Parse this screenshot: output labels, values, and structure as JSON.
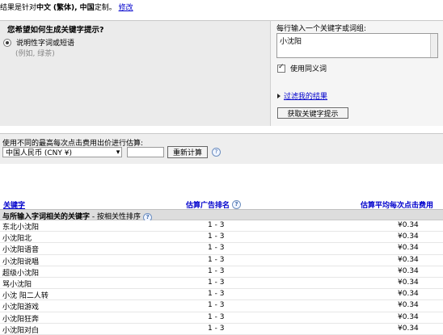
{
  "top": {
    "prefix": "结果是针对",
    "lang": "中文",
    "variant": "(繁体), 中国",
    "suffix": "定制。",
    "edit_link": "修改"
  },
  "question": {
    "title": "您希望如何生成关键字提示?",
    "option_label": "说明性字词或短语",
    "option_example": "(例如, 绿茶)"
  },
  "keywords_panel": {
    "label": "每行输入一个关键字或词组:",
    "value": "小沈阳",
    "synonyms_label": "使用同义词",
    "synonyms_checked": true,
    "filter_link": "过滤我的结果",
    "get_button": "获取关键字提示"
  },
  "cpc": {
    "label": "使用不同的最高每次点击费用出价进行估算:",
    "currency": "中国人民币 (CNY ¥)",
    "bid_value": "",
    "recalc_button": "重新计算"
  },
  "table": {
    "headers": {
      "keyword": "关键字",
      "rank": "估算广告排名",
      "cpc": "估算平均每次点击费用"
    },
    "section_title": "与所输入字词相关的关键字",
    "section_sort": " - 按相关性排序",
    "rows": [
      {
        "keyword": "东北小沈阳",
        "rank": "1 - 3",
        "cpc": "¥0.34"
      },
      {
        "keyword": "小沈阳北",
        "rank": "1 - 3",
        "cpc": "¥0.34"
      },
      {
        "keyword": "小沈阳语音",
        "rank": "1 - 3",
        "cpc": "¥0.34"
      },
      {
        "keyword": "小沈阳说唱",
        "rank": "1 - 3",
        "cpc": "¥0.34"
      },
      {
        "keyword": "超级小沈阳",
        "rank": "1 - 3",
        "cpc": "¥0.34"
      },
      {
        "keyword": "骂小沈阳",
        "rank": "1 - 3",
        "cpc": "¥0.34"
      },
      {
        "keyword": "小沈 阳二人转",
        "rank": "1 - 3",
        "cpc": "¥0.34"
      },
      {
        "keyword": "小沈阳游戏",
        "rank": "1 - 3",
        "cpc": "¥0.34"
      },
      {
        "keyword": "小沈阳狂奔",
        "rank": "1 - 3",
        "cpc": "¥0.34"
      },
      {
        "keyword": "小沈阳对白",
        "rank": "1 - 3",
        "cpc": "¥0.34"
      }
    ]
  },
  "colors": {
    "link": "#0000cc",
    "panel": "#ebebeb",
    "section": "#dddddd"
  },
  "icons": {
    "help": "help-icon",
    "radio": "radio-selected",
    "checkbox": "checkbox-checked",
    "expand": "triangle-right-icon"
  }
}
